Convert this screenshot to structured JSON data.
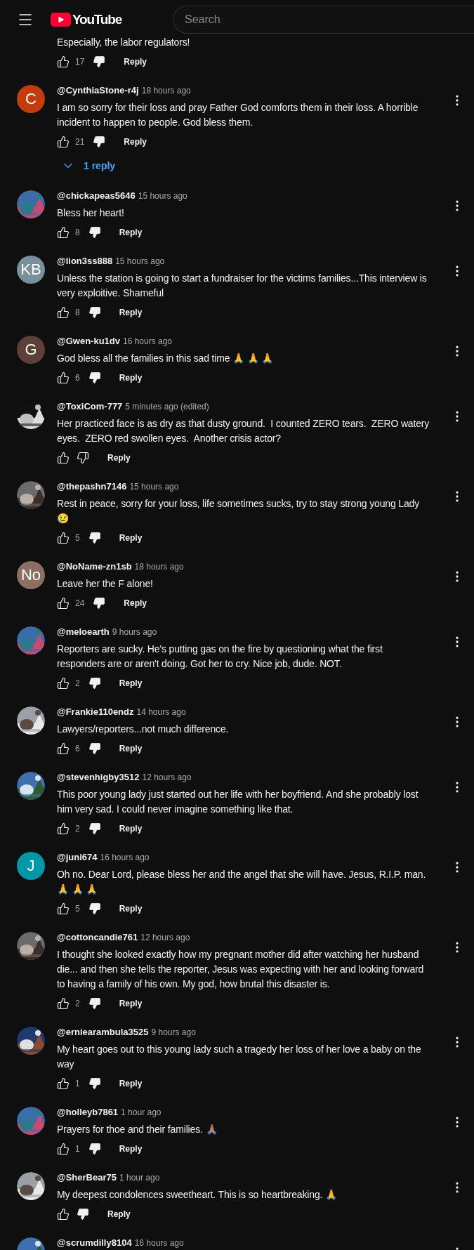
{
  "header": {
    "logo_text": "YouTube",
    "search": {
      "placeholder": "Search"
    }
  },
  "comments": [
    {
      "text": "Especially, the labor regulators!",
      "likes": "17",
      "disliked": true,
      "reply_label": "Reply"
    },
    {
      "avatar": {
        "kind": "letter",
        "letter": "C",
        "color": "#c23d0e"
      },
      "author": "@CynthiaStone-r4j",
      "time": "18 hours ago",
      "text": "I am so sorry for their loss and pray Father God comforts them in their loss. A horrible incident to happen to people. God bless them.",
      "likes": "21",
      "disliked": true,
      "reply_label": "Reply",
      "replies": "1 reply"
    },
    {
      "author": "@chickapeas5646",
      "time": "15 hours ago",
      "text": "Bless her heart!",
      "likes": "8",
      "disliked": true,
      "reply_label": "Reply"
    },
    {
      "avatar": {
        "kind": "letter",
        "letter": "KB",
        "color": "#78909c"
      },
      "author": "@lion3ss888",
      "time": "15 hours ago",
      "text": "Unless the station is going to start a fundraiser for the victims families...This interview is very exploitive. Shameful",
      "likes": "8",
      "disliked": true,
      "reply_label": "Reply"
    },
    {
      "avatar": {
        "kind": "letter",
        "letter": "G",
        "color": "#5d4037"
      },
      "author": "@Gwen-ku1dv",
      "time": "16 hours ago",
      "text": "God bless all the families in this sad time 🙏 🙏 🙏",
      "likes": "6",
      "disliked": true,
      "reply_label": "Reply"
    },
    {
      "author": "@ToxiCom-777",
      "time": "5 minutes ago (edited)",
      "text": "Her practiced face is as dry as that dusty ground.  I counted ZERO tears.  ZERO watery eyes.  ZERO red swollen eyes.  Another crisis actor?",
      "disliked": false,
      "reply_label": "Reply"
    },
    {
      "author": "@thepashn7146",
      "time": "15 hours ago",
      "text": "Rest in peace, sorry for your loss, life sometimes sucks, try to stay strong young Lady 😢",
      "likes": "5",
      "disliked": true,
      "reply_label": "Reply"
    },
    {
      "avatar": {
        "kind": "letter",
        "letter": "No",
        "color": "#8d6e63"
      },
      "author": "@NoName-zn1sb",
      "time": "18 hours ago",
      "text": "Leave her the F alone!",
      "likes": "24",
      "disliked": true,
      "reply_label": "Reply"
    },
    {
      "author": "@meloearth",
      "time": "9 hours ago",
      "text": "Reporters are sucky. He's putting gas on the fire by questioning what the first responders are or aren't doing. Got her to cry. Nice job, dude. NOT.",
      "likes": "2",
      "disliked": true,
      "reply_label": "Reply"
    },
    {
      "author": "@Frankie110endz",
      "time": "14 hours ago",
      "text": "Lawyers/reporters...not much difference.",
      "likes": "6",
      "disliked": true,
      "reply_label": "Reply"
    },
    {
      "author": "@stevenhigby3512",
      "time": "12 hours ago",
      "text": "This poor young lady just started out her life with her boyfriend. And she probably lost him very sad. I could never imagine something like that.",
      "likes": "2",
      "disliked": true,
      "reply_label": "Reply"
    },
    {
      "avatar": {
        "kind": "letter",
        "letter": "J",
        "color": "#0097a7"
      },
      "author": "@juni674",
      "time": "16 hours ago",
      "text": "Oh no. Dear Lord, please bless her and the angel that she will have. Jesus, R.I.P. man. 🙏 🙏 🙏",
      "likes": "5",
      "disliked": true,
      "reply_label": "Reply"
    },
    {
      "author": "@cottoncandie761",
      "time": "12 hours ago",
      "text": "I thought she looked exactly how my pregnant mother did after watching her husband die... and then she tells the reporter, Jesus was expecting with her and looking forward to having a family of his own. My god, how brutal this disaster is.",
      "likes": "2",
      "disliked": true,
      "reply_label": "Reply"
    },
    {
      "author": "@erniearambula3525",
      "time": "9 hours ago",
      "text": "My heart goes out to this young lady such a tragedy her loss of her love a baby on the way",
      "likes": "1",
      "disliked": true,
      "reply_label": "Reply"
    },
    {
      "author": "@holleyb7861",
      "time": "1 hour ago",
      "text": "Prayers for thoe and their families. 🙏🏽",
      "likes": "1",
      "disliked": true,
      "reply_label": "Reply"
    },
    {
      "author": "@SherBear75",
      "time": "1 hour ago",
      "text": "My deepest condolences sweetheart. This is so heartbreaking. 🙏",
      "disliked": true,
      "reply_label": "Reply"
    },
    {
      "author": "@scrumdilly8104",
      "time": "16 hours ago"
    }
  ]
}
